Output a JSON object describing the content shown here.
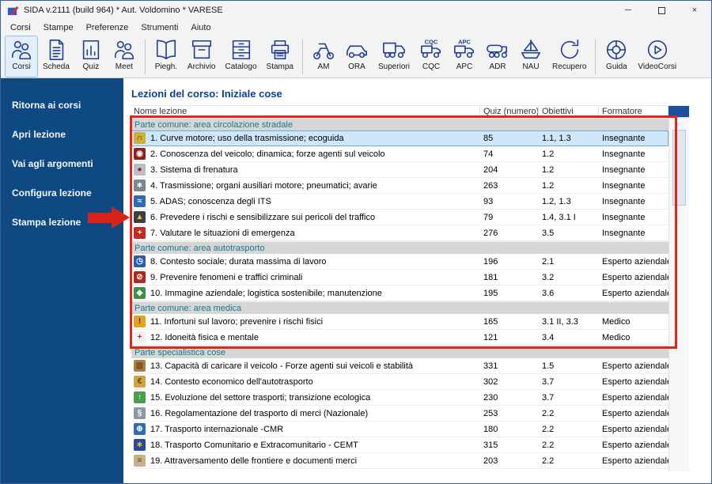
{
  "window": {
    "title": "SIDA v.2111 (build 964) * Aut. Voldomino * VARESE",
    "controls": {
      "minimize_glyph": "─",
      "close_glyph": "×"
    }
  },
  "menubar": {
    "items": [
      "Corsi",
      "Stampe",
      "Preferenze",
      "Strumenti",
      "Aiuto"
    ]
  },
  "toolbar": {
    "groups": [
      {
        "items": [
          {
            "label": "Corsi",
            "icon": "people",
            "selected": true
          },
          {
            "label": "Scheda",
            "icon": "doc"
          },
          {
            "label": "Quiz",
            "icon": "chartdoc"
          },
          {
            "label": "Meet",
            "icon": "people"
          }
        ]
      },
      {
        "items": [
          {
            "label": "Piegh.",
            "icon": "book"
          },
          {
            "label": "Archivio",
            "icon": "box"
          },
          {
            "label": "Catalogo",
            "icon": "catalog"
          },
          {
            "label": "Stampa",
            "icon": "printer"
          }
        ]
      },
      {
        "items": [
          {
            "label": "AM",
            "icon": "moped"
          },
          {
            "label": "ORA",
            "icon": "car"
          },
          {
            "label": "Superiori",
            "icon": "truck"
          },
          {
            "label": "CQC",
            "icon": "truck-cqc"
          },
          {
            "label": "APC",
            "icon": "truck-apc"
          },
          {
            "label": "ADR",
            "icon": "tanker"
          },
          {
            "label": "NAU",
            "icon": "boat"
          },
          {
            "label": "Recupero",
            "icon": "refresh"
          }
        ]
      },
      {
        "items": [
          {
            "label": "Guida",
            "icon": "lifebuoy"
          },
          {
            "label": "VideoCorsi",
            "icon": "play-circle"
          }
        ]
      }
    ]
  },
  "sidebar": {
    "items": [
      "Ritorna ai corsi",
      "Apri lezione",
      "Vai agli argomenti",
      "Configura lezione",
      "Stampa lezione"
    ]
  },
  "main": {
    "title": "Lezioni del corso: Iniziale cose",
    "columns": [
      "Nome lezione",
      "Quiz (numero)",
      "Obiettivi",
      "Formatore"
    ],
    "sections": [
      {
        "title": "Parte comune: area circolazione stradale",
        "rows": [
          {
            "name": "1. Curve motore; uso della trasmissione; ecoguida",
            "quiz": "85",
            "obiettivi": "1.1, 1.3",
            "formatore": "Insegnante",
            "selected": true,
            "icon": {
              "bg": "#cfae3a",
              "glyph": "∩",
              "fg": "#2d2d2d"
            }
          },
          {
            "name": "2. Conoscenza del veicolo; dinamica; forze agenti sul veicolo",
            "quiz": "74",
            "obiettivi": "1.2",
            "formatore": "Insegnante",
            "icon": {
              "bg": "#8c2222",
              "glyph": "◉",
              "fg": "#f2f2f2"
            }
          },
          {
            "name": "3. Sistema di frenatura",
            "quiz": "204",
            "obiettivi": "1.2",
            "formatore": "Insegnante",
            "icon": {
              "bg": "#b9bec4",
              "glyph": "●",
              "fg": "#a32020"
            }
          },
          {
            "name": "4. Trasmissione; organi ausiliari motore; pneumatici; avarie",
            "quiz": "263",
            "obiettivi": "1.2",
            "formatore": "Insegnante",
            "icon": {
              "bg": "#7d858d",
              "glyph": "∗",
              "fg": "#ffffff"
            }
          },
          {
            "name": "5. ADAS; conoscenza degli ITS",
            "quiz": "93",
            "obiettivi": "1.2, 1.3",
            "formatore": "Insegnante",
            "icon": {
              "bg": "#2f6cb4",
              "glyph": "≈",
              "fg": "#ffffff"
            }
          },
          {
            "name": "6. Prevedere i rischi e sensibilizzare sui pericoli del traffico",
            "quiz": "79",
            "obiettivi": "1.4, 3.1 I",
            "formatore": "Insegnante",
            "icon": {
              "bg": "#3c4048",
              "glyph": "▲",
              "fg": "#f2c12e"
            }
          },
          {
            "name": "7. Valutare le situazioni di emergenza",
            "quiz": "276",
            "obiettivi": "3.5",
            "formatore": "Insegnante",
            "icon": {
              "bg": "#c42a1f",
              "glyph": "+",
              "fg": "#ffffff"
            }
          }
        ]
      },
      {
        "title": "Parte comune: area autotrasporto",
        "rows": [
          {
            "name": "8. Contesto sociale; durata massima di lavoro",
            "quiz": "196",
            "obiettivi": "2.1",
            "formatore": "Esperto aziendale",
            "icon": {
              "bg": "#2b5fae",
              "glyph": "◷",
              "fg": "#ffffff"
            }
          },
          {
            "name": "9. Prevenire fenomeni e traffici criminali",
            "quiz": "181",
            "obiettivi": "3.2",
            "formatore": "Esperto aziendale",
            "icon": {
              "bg": "#b3271b",
              "glyph": "⊘",
              "fg": "#ffffff"
            }
          },
          {
            "name": "10. Immagine aziendale; logistica sostenibile; manutenzione",
            "quiz": "195",
            "obiettivi": "3.6",
            "formatore": "Esperto aziendale",
            "icon": {
              "bg": "#3f8f45",
              "glyph": "◆",
              "fg": "#ffffff"
            }
          }
        ]
      },
      {
        "title": "Parte comune: area medica",
        "rows": [
          {
            "name": "11. Infortuni sul lavoro; prevenire i rischi fisici",
            "quiz": "165",
            "obiettivi": "3.1 II, 3.3",
            "formatore": "Medico",
            "icon": {
              "bg": "#e2a41f",
              "glyph": "!",
              "fg": "#2d2d2d"
            }
          },
          {
            "name": "12. Idoneità fisica e mentale",
            "quiz": "121",
            "obiettivi": "3.4",
            "formatore": "Medico",
            "icon": {
              "bg": "#f0f0f0",
              "glyph": "+",
              "fg": "#c42a1f"
            }
          }
        ]
      },
      {
        "title": "Parte specialistica cose",
        "rows": [
          {
            "name": "13. Capacità di caricare il veicolo - Forze agenti sui veicoli e stabilità",
            "quiz": "331",
            "obiettivi": "1.5",
            "formatore": "Esperto aziendale",
            "icon": {
              "bg": "#b08043",
              "glyph": "▥",
              "fg": "#6e4d1f"
            }
          },
          {
            "name": "14. Contesto economico dell'autotrasporto",
            "quiz": "302",
            "obiettivi": "3.7",
            "formatore": "Esperto aziendale",
            "icon": {
              "bg": "#d1a43c",
              "glyph": "€",
              "fg": "#5f450f"
            }
          },
          {
            "name": "15. Evoluzione del settore trasporti; transizione ecologica",
            "quiz": "230",
            "obiettivi": "3.7",
            "formatore": "Esperto aziendale",
            "icon": {
              "bg": "#4a9e4f",
              "glyph": "↑",
              "fg": "#ffffff"
            }
          },
          {
            "name": "16. Regolamentazione del trasporto di merci (Nazionale)",
            "quiz": "253",
            "obiettivi": "2.2",
            "formatore": "Esperto aziendale",
            "icon": {
              "bg": "#8f98a1",
              "glyph": "§",
              "fg": "#ffffff"
            }
          },
          {
            "name": "17. Trasporto internazionale -CMR",
            "quiz": "180",
            "obiettivi": "2.2",
            "formatore": "Esperto aziendale",
            "icon": {
              "bg": "#2e6db6",
              "glyph": "⊕",
              "fg": "#ffffff"
            }
          },
          {
            "name": "18. Trasporto Comunitario e Extracomunitario - CEMT",
            "quiz": "315",
            "obiettivi": "2.2",
            "formatore": "Esperto aziendale",
            "icon": {
              "bg": "#27489c",
              "glyph": "∗",
              "fg": "#f2c12e"
            }
          },
          {
            "name": "19. Attraversamento delle frontiere e documenti merci",
            "quiz": "203",
            "obiettivi": "2.2",
            "formatore": "Esperto aziendale",
            "icon": {
              "bg": "#c7b087",
              "glyph": "≡",
              "fg": "#5d4a26"
            }
          }
        ]
      }
    ]
  },
  "annotations": {
    "highlight_box_color": "#e0251b",
    "arrow_color": "#d92318",
    "arrow_points_to": "6. Prevedere i rischi e sensibilizzare sui pericoli del traffico"
  }
}
